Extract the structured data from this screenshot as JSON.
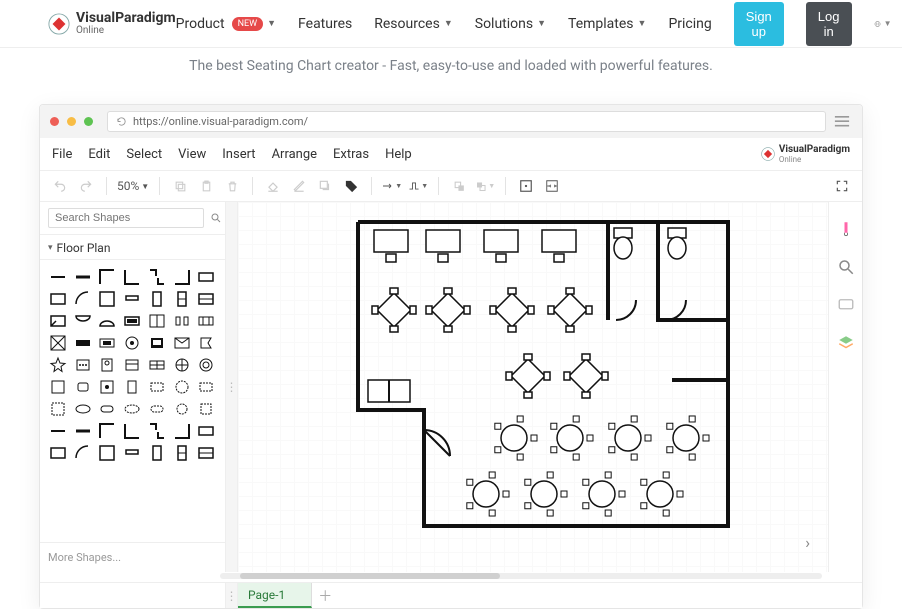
{
  "nav": {
    "brand_top": "VisualParadigm",
    "brand_sub": "Online",
    "items": [
      {
        "label": "Product",
        "badge": "NEW",
        "dropdown": true
      },
      {
        "label": "Features",
        "dropdown": false
      },
      {
        "label": "Resources",
        "dropdown": true
      },
      {
        "label": "Solutions",
        "dropdown": true
      },
      {
        "label": "Templates",
        "dropdown": true
      },
      {
        "label": "Pricing",
        "dropdown": false
      }
    ],
    "signup": "Sign up",
    "login": "Log in"
  },
  "tagline": "The best Seating Chart creator - Fast, easy-to-use and loaded with powerful features.",
  "browser": {
    "url": "https://online.visual-paradigm.com/"
  },
  "menu": {
    "items": [
      "File",
      "Edit",
      "Select",
      "View",
      "Insert",
      "Arrange",
      "Extras",
      "Help"
    ]
  },
  "vp_badge_top": "VisualParadigm",
  "vp_badge_sub": "Online",
  "toolbar": {
    "zoom": "50%"
  },
  "left_panel": {
    "search_placeholder": "Search Shapes",
    "section_title": "Floor Plan",
    "more_shapes": "More Shapes...",
    "shape_count": 63
  },
  "tabs": {
    "active": "Page-1"
  }
}
